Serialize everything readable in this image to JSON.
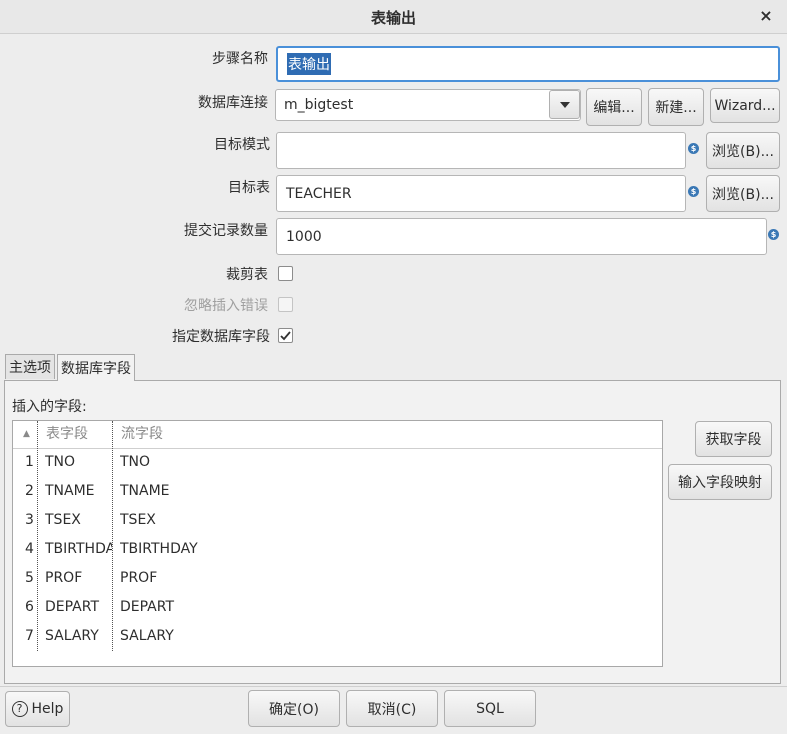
{
  "window": {
    "title": "表输出",
    "close_glyph": "×"
  },
  "form": {
    "step_name_label": "步骤名称",
    "step_name_value": "表输出",
    "connection_label": "数据库连接",
    "connection_value": "m_bigtest",
    "edit_button": "编辑...",
    "new_button": "新建...",
    "wizard_button": "Wizard...",
    "target_schema_label": "目标模式",
    "target_schema_value": "",
    "browse_schema_button": "浏览(B)...",
    "target_table_label": "目标表",
    "target_table_value": "TEACHER",
    "browse_table_button": "浏览(B)...",
    "commit_size_label": "提交记录数量",
    "commit_size_value": "1000",
    "truncate_label": "裁剪表",
    "truncate_checked": false,
    "ignore_errors_label": "忽略插入错误",
    "ignore_errors_checked": false,
    "specify_fields_label": "指定数据库字段",
    "specify_fields_checked": true,
    "variable_icon_glyph": "$"
  },
  "tabs": [
    {
      "label": "主选项",
      "active": false
    },
    {
      "label": "数据库字段",
      "active": true
    }
  ],
  "fields_tab": {
    "section_label": "插入的字段:",
    "sort_glyph": "▲",
    "columns": [
      "表字段",
      "流字段"
    ],
    "rows": [
      {
        "num": "1",
        "table_field": "TNO",
        "stream_field": "TNO"
      },
      {
        "num": "2",
        "table_field": "TNAME",
        "stream_field": "TNAME"
      },
      {
        "num": "3",
        "table_field": "TSEX",
        "stream_field": "TSEX"
      },
      {
        "num": "4",
        "table_field": "TBIRTHDAY",
        "stream_field": "TBIRTHDAY"
      },
      {
        "num": "5",
        "table_field": "PROF",
        "stream_field": "PROF"
      },
      {
        "num": "6",
        "table_field": "DEPART",
        "stream_field": "DEPART"
      },
      {
        "num": "7",
        "table_field": "SALARY",
        "stream_field": "SALARY"
      }
    ],
    "get_fields_button": "获取字段",
    "input_mapping_button": "输入字段映射"
  },
  "footer": {
    "help_button": "Help",
    "help_icon_glyph": "?",
    "ok_button": "确定(O)",
    "cancel_button": "取消(C)",
    "sql_button": "SQL"
  },
  "colors": {
    "accent": "#4a90d9",
    "selection": "#2f6cb3",
    "variable_icon": "#3a78b5"
  }
}
